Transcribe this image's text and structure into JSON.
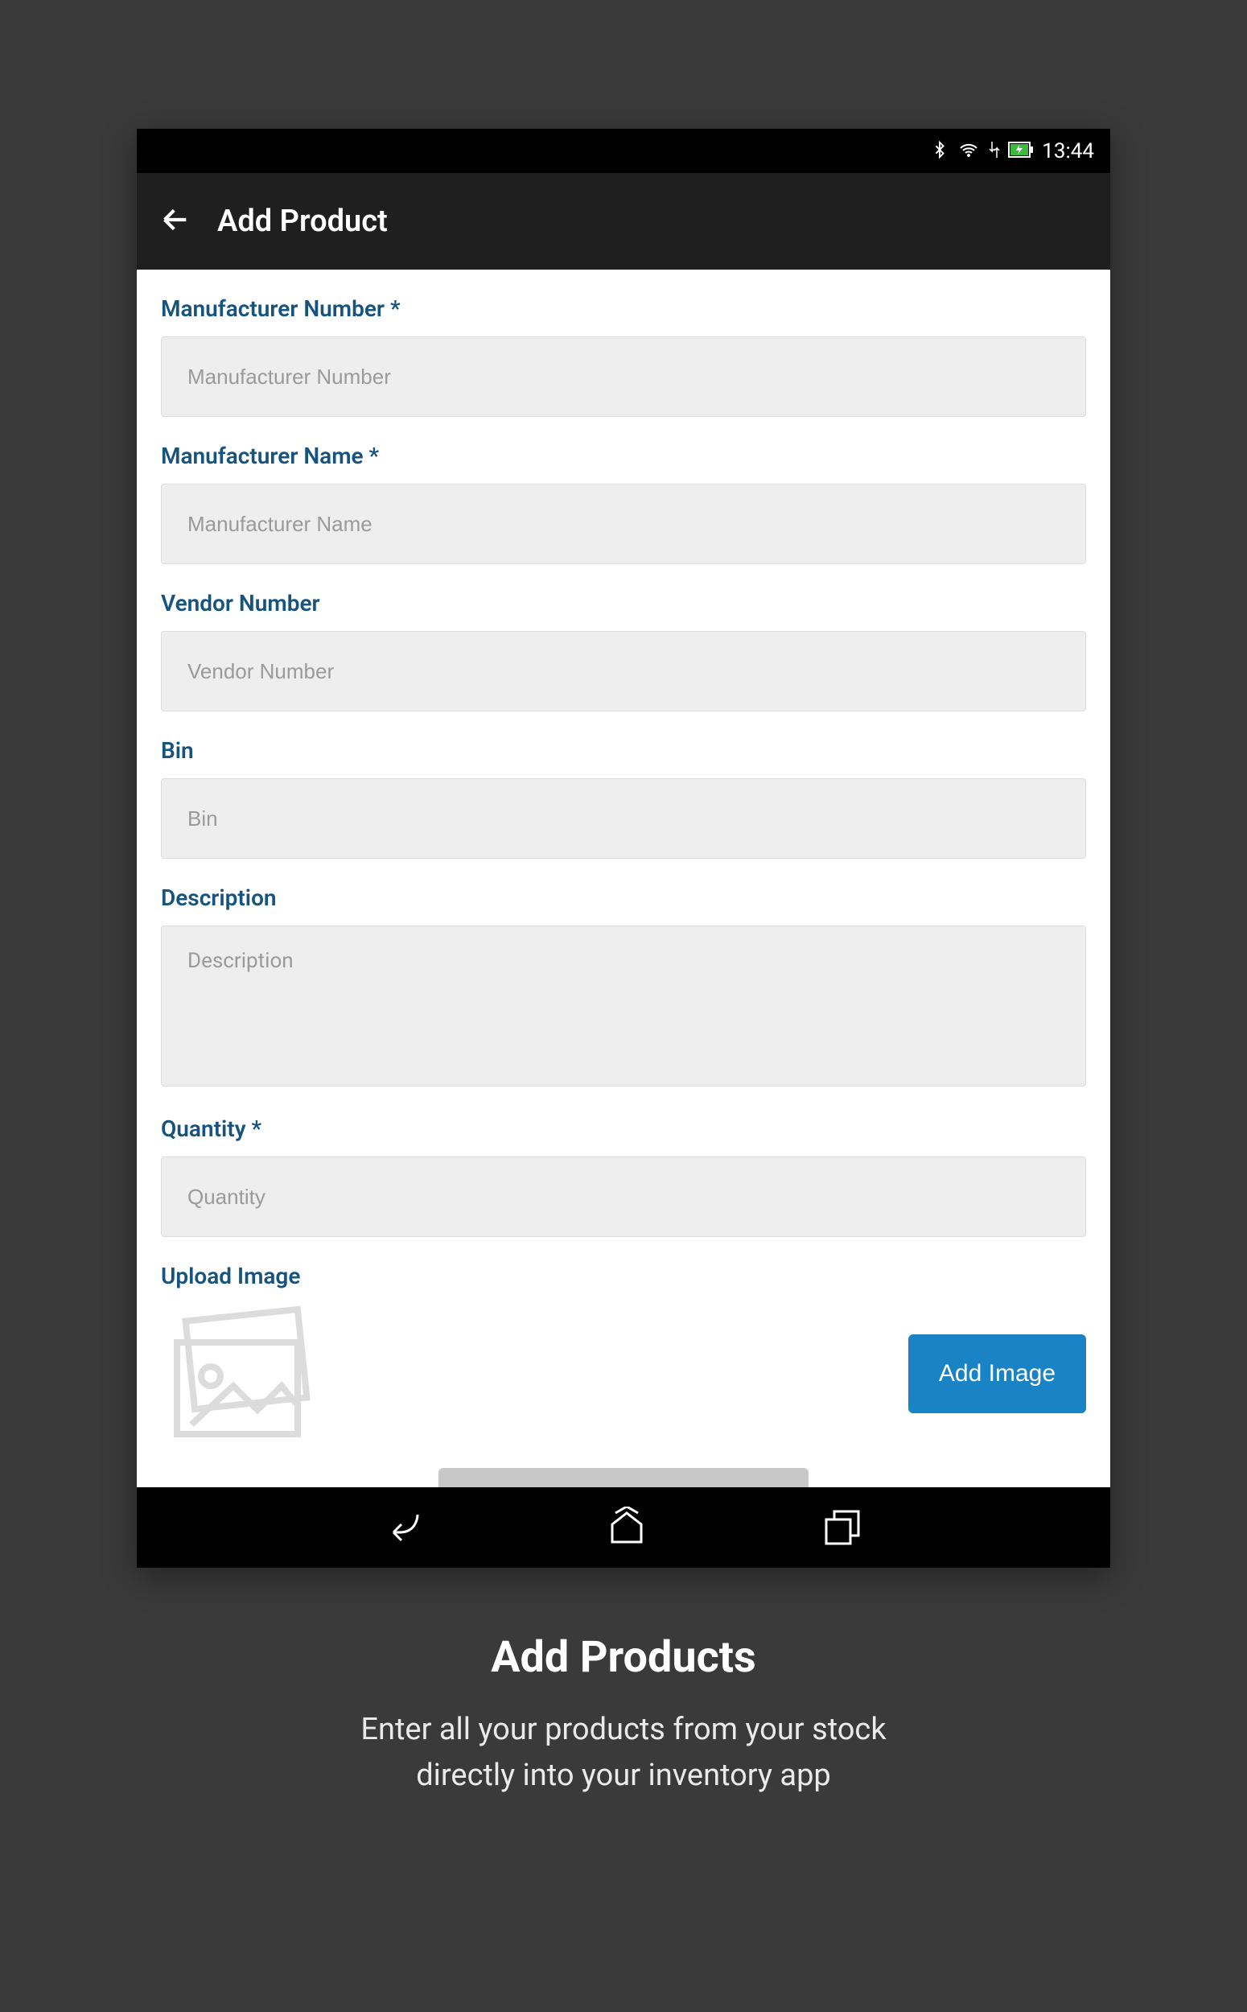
{
  "statusBar": {
    "time": "13:44"
  },
  "appBar": {
    "title": "Add Product"
  },
  "form": {
    "manufacturerNumber": {
      "label": "Manufacturer Number *",
      "placeholder": "Manufacturer Number"
    },
    "manufacturerName": {
      "label": "Manufacturer Name *",
      "placeholder": "Manufacturer Name"
    },
    "vendorNumber": {
      "label": "Vendor Number",
      "placeholder": "Vendor Number"
    },
    "bin": {
      "label": "Bin",
      "placeholder": "Bin"
    },
    "description": {
      "label": "Description",
      "placeholder": "Description"
    },
    "quantity": {
      "label": "Quantity *",
      "placeholder": "Quantity"
    },
    "uploadImage": {
      "label": "Upload Image",
      "buttonLabel": "Add Image"
    }
  },
  "caption": {
    "title": "Add Products",
    "subtitle1": "Enter all your products from your stock",
    "subtitle2": "directly into your inventory app"
  }
}
